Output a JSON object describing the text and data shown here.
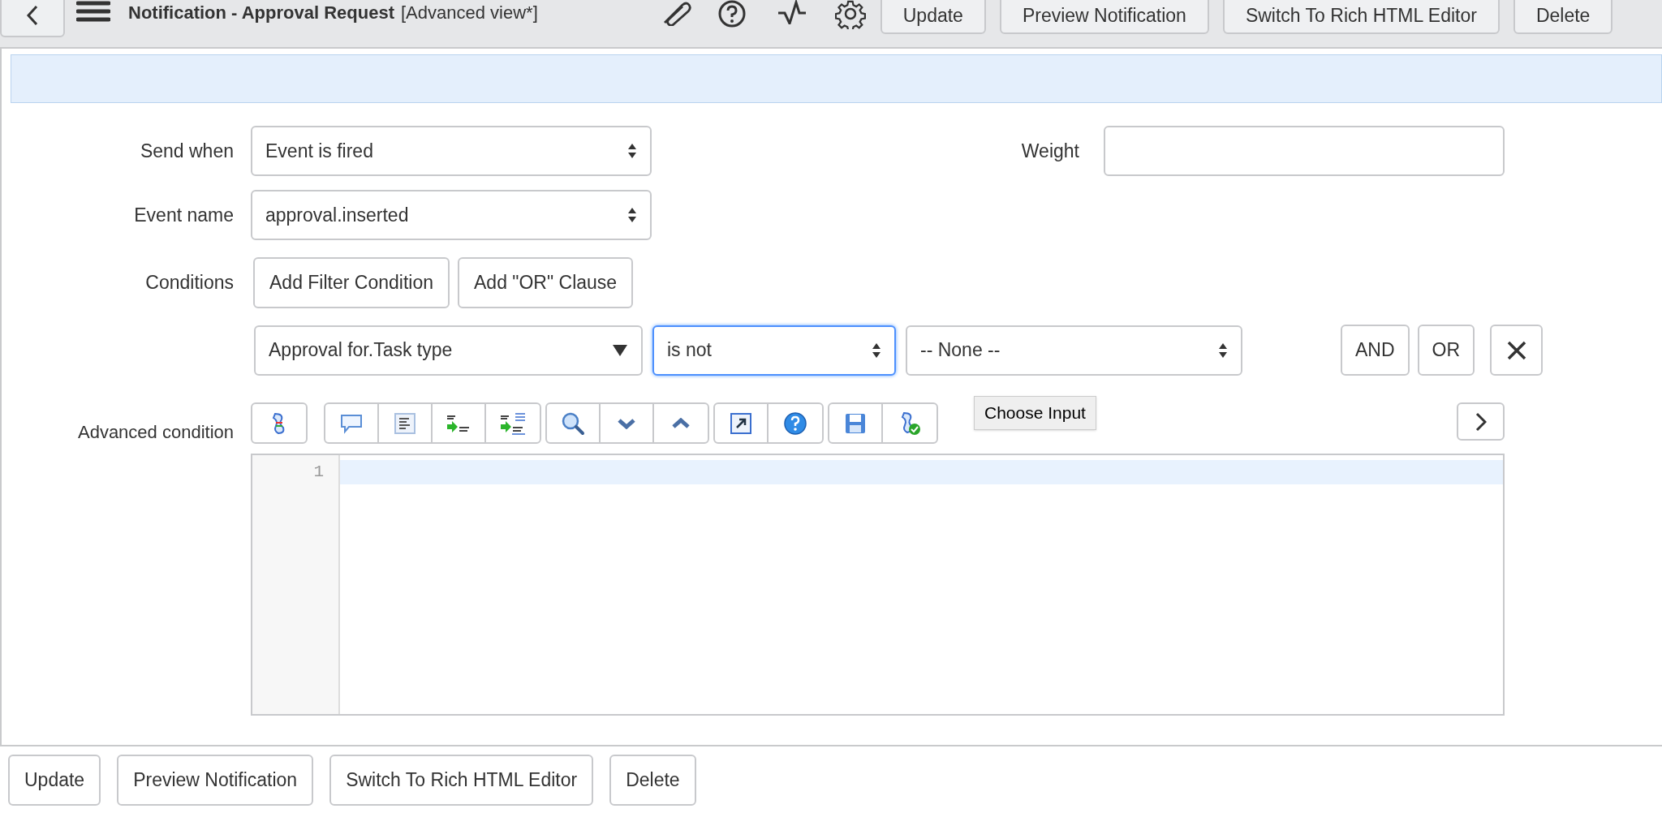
{
  "header": {
    "title": "Notification - Approval Request",
    "view_label": "[Advanced view*]",
    "buttons": [
      "Update",
      "Preview Notification",
      "Switch To Rich HTML Editor",
      "Delete"
    ]
  },
  "form": {
    "send_when": {
      "label": "Send when",
      "value": "Event is fired"
    },
    "weight": {
      "label": "Weight"
    },
    "event_name": {
      "label": "Event name",
      "value": "approval.inserted"
    },
    "conditions": {
      "label": "Conditions",
      "buttons": [
        "Add Filter Condition",
        "Add \"OR\" Clause"
      ],
      "row": {
        "fields": [
          {
            "kind": "reference",
            "value": "Approval for.Task type",
            "focused": false
          },
          {
            "kind": "select",
            "value": "is not",
            "focused": true
          },
          {
            "kind": "select",
            "value": "-- None --",
            "focused": false
          }
        ],
        "buttons": [
          "AND",
          "OR"
        ]
      }
    },
    "advanced_condition": {
      "label": "Advanced condition",
      "tooltip": "Choose Input",
      "line_numbers": [
        "1"
      ]
    }
  },
  "footer": {
    "buttons": [
      "Update",
      "Preview Notification",
      "Switch To Rich HTML Editor",
      "Delete"
    ]
  }
}
